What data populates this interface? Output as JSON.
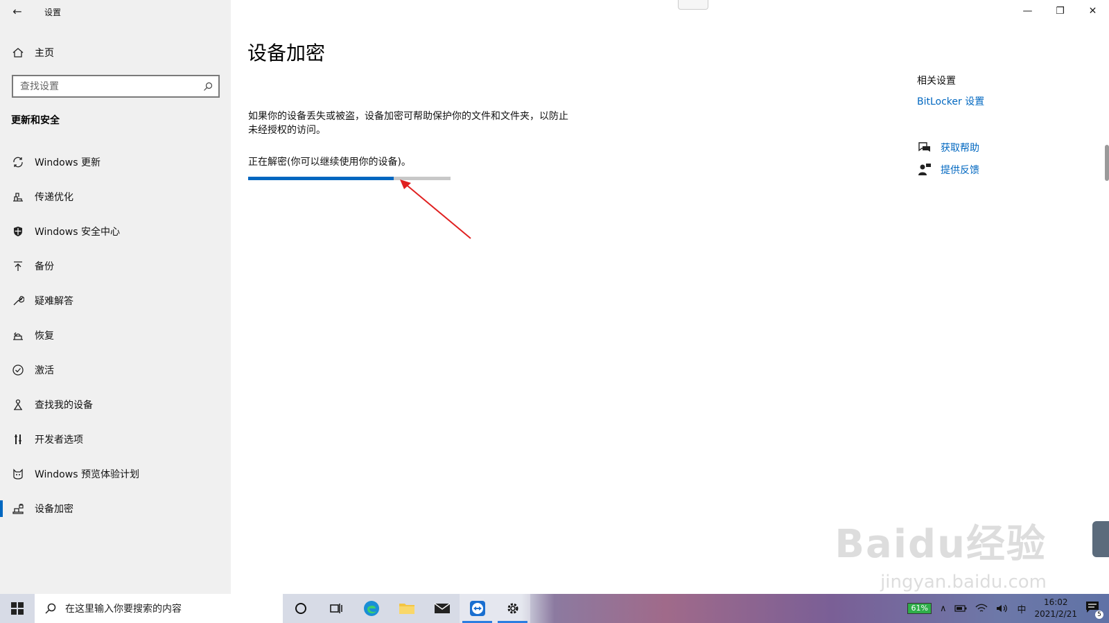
{
  "window": {
    "title": "设置",
    "back_icon": "back-arrow-icon",
    "controls": {
      "minimize": "—",
      "restore": "❐",
      "close": "✕"
    }
  },
  "sidebar": {
    "home_label": "主页",
    "search_placeholder": "查找设置",
    "section_title": "更新和安全",
    "items": [
      {
        "label": "Windows 更新",
        "icon": "sync-icon"
      },
      {
        "label": "传递优化",
        "icon": "delivery-optimization-icon"
      },
      {
        "label": "Windows 安全中心",
        "icon": "shield-icon"
      },
      {
        "label": "备份",
        "icon": "backup-arrow-icon"
      },
      {
        "label": "疑难解答",
        "icon": "wrench-icon"
      },
      {
        "label": "恢复",
        "icon": "recovery-icon"
      },
      {
        "label": "激活",
        "icon": "check-circle-icon"
      },
      {
        "label": "查找我的设备",
        "icon": "person-location-icon"
      },
      {
        "label": "开发者选项",
        "icon": "developer-tools-icon"
      },
      {
        "label": "Windows 预览体验计划",
        "icon": "insider-cat-icon"
      },
      {
        "label": "设备加密",
        "icon": "device-encryption-icon",
        "active": true
      }
    ]
  },
  "main": {
    "title": "设备加密",
    "description": "如果你的设备丢失或被盗，设备加密可帮助保护你的文件和文件夹，以防止未经授权的访问。",
    "status": "正在解密(你可以继续使用你的设备)。",
    "progress_fraction": 0.72,
    "related_title": "相关设置",
    "bitlocker_link": "BitLocker 设置",
    "help_link": "获取帮助",
    "feedback_link": "提供反馈"
  },
  "watermark": {
    "brand": "Baidu经验",
    "url": "jingyan.baidu.com"
  },
  "taskbar": {
    "search_placeholder": "在这里输入你要搜索的内容",
    "battery": "61%",
    "ime": "中",
    "time": "16:02",
    "date": "2021/2/21",
    "notifications": "5"
  },
  "colors": {
    "accent": "#0067c0",
    "sidebar_bg": "#f0f0f0",
    "arrow": "#e02020"
  }
}
